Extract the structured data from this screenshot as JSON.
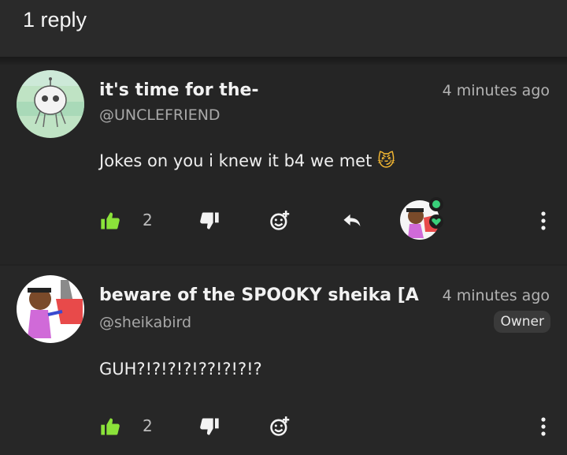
{
  "header": {
    "title": "1 reply"
  },
  "comments": [
    {
      "name": "it's time for the-",
      "handle": "@UNCLEFRIEND",
      "time": "4 minutes ago",
      "text": "Jokes on you i knew it b4 we met",
      "emoji": "😼",
      "likes": "2"
    },
    {
      "name": "beware of the SPOOKY sheika [A",
      "handle": "@sheikabird",
      "time": "4 minutes ago",
      "badge": "Owner",
      "text": "GUH?!?!?!?!??!?!?!?",
      "likes": "2"
    }
  ],
  "colors": {
    "like_green": "#8be23a",
    "heart_green": "#39d07a"
  }
}
